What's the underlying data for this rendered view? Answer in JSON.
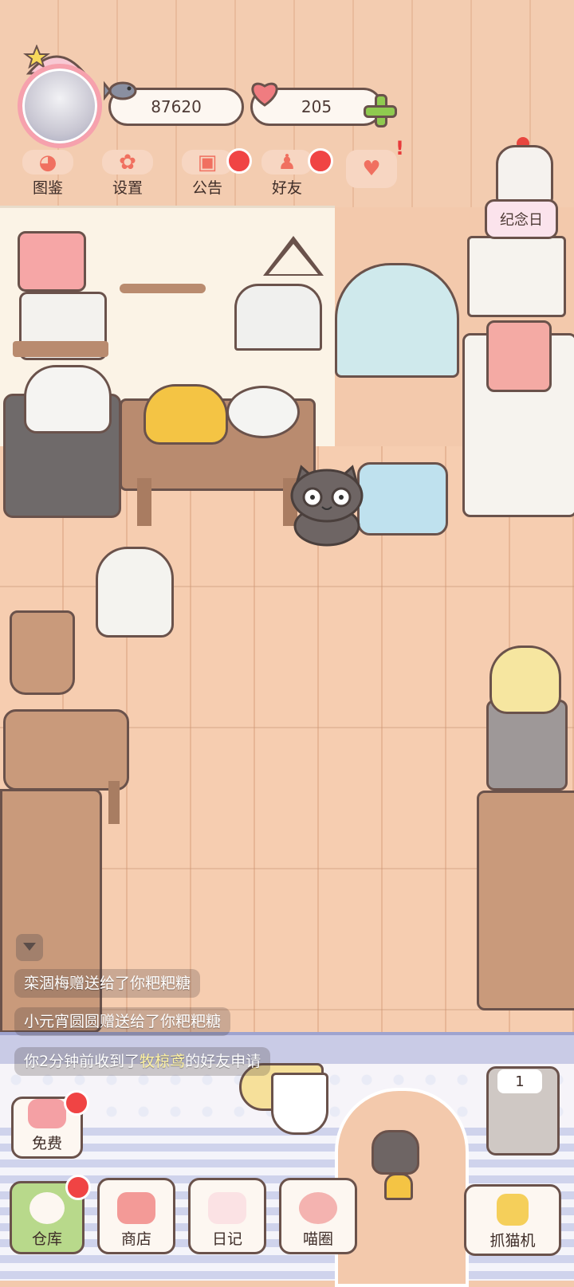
{
  "hud": {
    "fish_count": "87620",
    "heart_count": "205"
  },
  "menu": [
    {
      "label": "图鉴",
      "icon": "cat-face-icon",
      "badge": false
    },
    {
      "label": "设置",
      "icon": "gear-icon",
      "badge": false
    },
    {
      "label": "公告",
      "icon": "gift-icon",
      "badge": true
    },
    {
      "label": "好友",
      "icon": "friends-icon",
      "badge": true
    },
    {
      "label": "",
      "icon": "hearts-icon",
      "badge": "!"
    }
  ],
  "anniversary_label": "纪念日",
  "chat": {
    "messages": [
      {
        "text": "栾涸梅赠送给了你粑粑糖"
      },
      {
        "text": "小元宵圆圆赠送给了你粑粑糖"
      },
      {
        "pre": "你2分钟前收到了",
        "name": "牧椋鸢",
        "post": "的好友申请"
      }
    ]
  },
  "bottom": {
    "free_label": "免费",
    "storage_label": "仓库",
    "shop_label": "商店",
    "diary_label": "日记",
    "circle_label": "喵圈",
    "claw_label": "抓猫机",
    "counter_value": "1"
  },
  "colors": {
    "badge": "#f04444",
    "accent": "#f07060",
    "outline": "#6a524b",
    "plus": "#8fca4f",
    "storage_active": "#b8d98b"
  }
}
